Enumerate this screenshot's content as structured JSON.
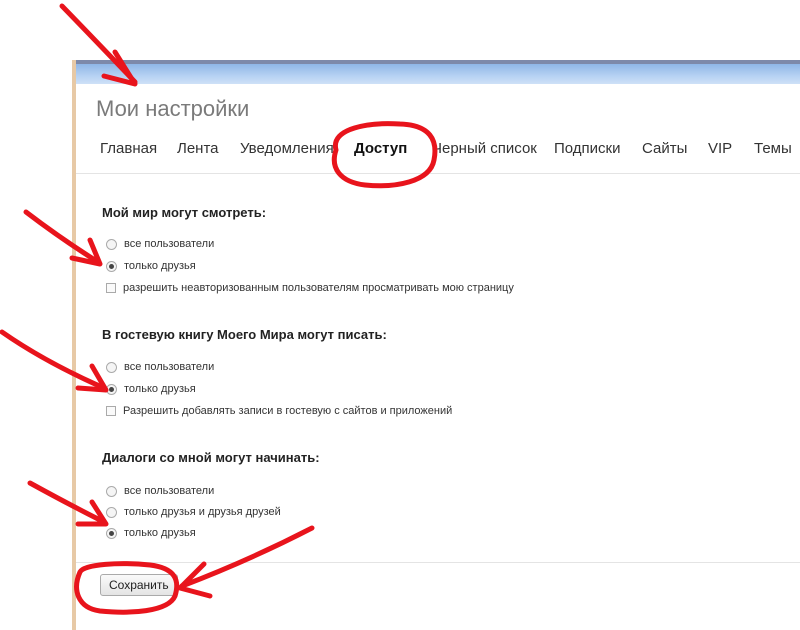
{
  "page": {
    "title": "Мои настройки",
    "tabs": [
      {
        "label": "Главная"
      },
      {
        "label": "Лента"
      },
      {
        "label": "Уведомления"
      },
      {
        "label": "Доступ",
        "active": true
      },
      {
        "label": "Черный список"
      },
      {
        "label": "Подписки"
      },
      {
        "label": "Сайты"
      },
      {
        "label": "VIP"
      },
      {
        "label": "Темы"
      }
    ]
  },
  "sections": [
    {
      "title": "Мой мир могут смотреть:",
      "options": [
        {
          "type": "radio",
          "label": "все пользователи",
          "checked": false
        },
        {
          "type": "radio",
          "label": "только друзья",
          "checked": true
        },
        {
          "type": "checkbox",
          "label": "разрешить неавторизованным пользователям просматривать мою страницу",
          "checked": false
        }
      ]
    },
    {
      "title": "В гостевую книгу Моего Мира могут писать:",
      "options": [
        {
          "type": "radio",
          "label": "все пользователи",
          "checked": false
        },
        {
          "type": "radio",
          "label": "только друзья",
          "checked": true
        },
        {
          "type": "checkbox",
          "label": "Разрешить добавлять записи в гостевую с сайтов и приложений",
          "checked": false
        }
      ]
    },
    {
      "title": "Диалоги со мной могут начинать:",
      "options": [
        {
          "type": "radio",
          "label": "все пользователи",
          "checked": false
        },
        {
          "type": "radio",
          "label": "только друзья и друзья друзей",
          "checked": false
        },
        {
          "type": "radio",
          "label": "только друзья",
          "checked": true
        }
      ]
    }
  ],
  "save_label": "Сохранить",
  "colors": {
    "annotation": "#e8141c",
    "header_band": "#b7d2f3"
  }
}
